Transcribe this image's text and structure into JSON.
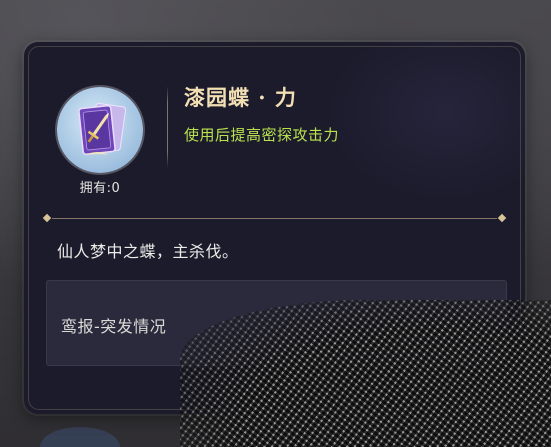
{
  "item": {
    "name": "漆园蝶 · 力",
    "effect": "使用后提高密探攻击力",
    "owned_label": "拥有:0",
    "icon": "purple-card-sword-icon"
  },
  "description": "仙人梦中之蝶，主杀伐。",
  "source": {
    "label": "鸾报-突发情况"
  },
  "colors": {
    "panel_bg": "#1c1b2c",
    "name_color": "#f2dfb4",
    "effect_color": "#b9e24e",
    "divider_gold": "#d6c496"
  }
}
